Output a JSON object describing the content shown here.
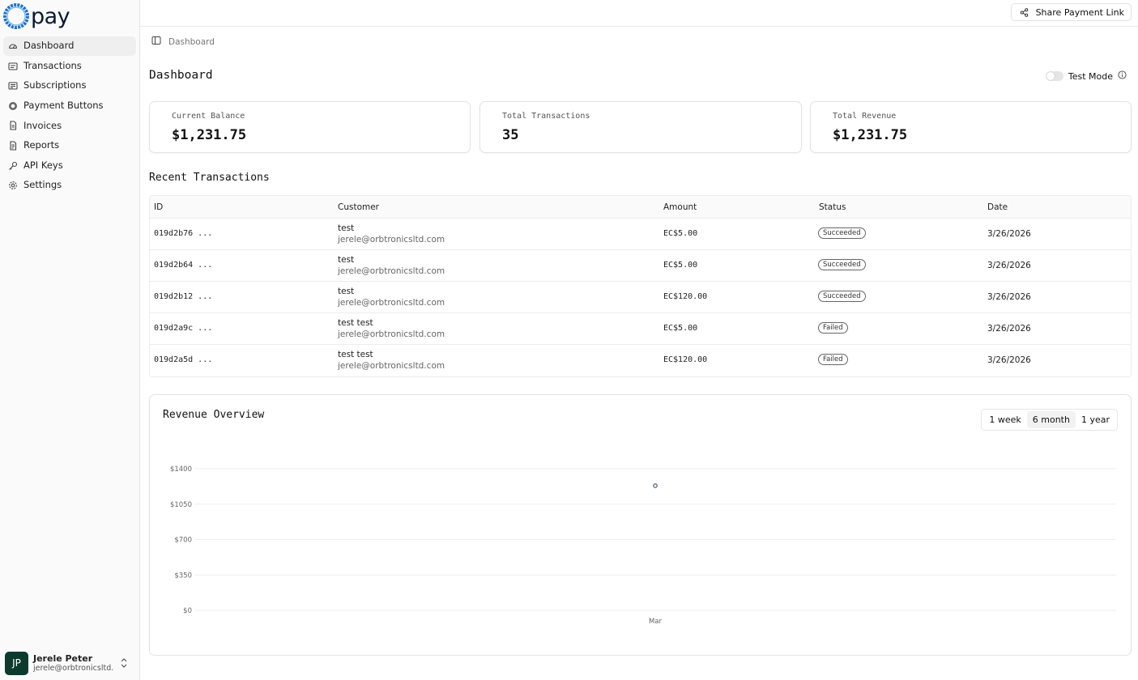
{
  "app": {
    "logo_text": "pay"
  },
  "sidebar": {
    "items": [
      {
        "label": "Dashboard",
        "icon": "gauge-icon",
        "active": true
      },
      {
        "label": "Transactions",
        "icon": "receipt-icon"
      },
      {
        "label": "Subscriptions",
        "icon": "layers-icon"
      },
      {
        "label": "Payment Buttons",
        "icon": "globe-icon"
      },
      {
        "label": "Invoices",
        "icon": "file-icon"
      },
      {
        "label": "Reports",
        "icon": "report-icon"
      },
      {
        "label": "API Keys",
        "icon": "key-icon"
      },
      {
        "label": "Settings",
        "icon": "gear-icon"
      }
    ]
  },
  "user": {
    "initials": "JP",
    "name": "Jerele Peter",
    "email": "jerele@orbtronicsltd...."
  },
  "topbar": {
    "share_label": "Share Payment Link"
  },
  "breadcrumb": {
    "current": "Dashboard"
  },
  "page": {
    "title": "Dashboard",
    "test_mode_label": "Test Mode"
  },
  "stats": {
    "balance": {
      "label": "Current Balance",
      "value": "$1,231.75"
    },
    "transactions": {
      "label": "Total Transactions",
      "value": "35"
    },
    "revenue": {
      "label": "Total Revenue",
      "value": "$1,231.75"
    }
  },
  "recent": {
    "title": "Recent Transactions",
    "columns": [
      "ID",
      "Customer",
      "Amount",
      "Status",
      "Date"
    ],
    "rows": [
      {
        "id": "019d2b76 ...",
        "name": "test",
        "email": "jerele@orbtronicsltd.com",
        "amount": "EC$5.00",
        "status": "Succeeded",
        "date": "3/26/2026"
      },
      {
        "id": "019d2b64 ...",
        "name": "test",
        "email": "jerele@orbtronicsltd.com",
        "amount": "EC$5.00",
        "status": "Succeeded",
        "date": "3/26/2026"
      },
      {
        "id": "019d2b12 ...",
        "name": "test",
        "email": "jerele@orbtronicsltd.com",
        "amount": "EC$120.00",
        "status": "Succeeded",
        "date": "3/26/2026"
      },
      {
        "id": "019d2a9c ...",
        "name": "test test",
        "email": "jerele@orbtronicsltd.com",
        "amount": "EC$5.00",
        "status": "Failed",
        "date": "3/26/2026"
      },
      {
        "id": "019d2a5d ...",
        "name": "test test",
        "email": "jerele@orbtronicsltd.com",
        "amount": "EC$120.00",
        "status": "Failed",
        "date": "3/26/2026"
      }
    ]
  },
  "overview": {
    "title": "Revenue Overview",
    "ranges": [
      {
        "label": "1 week"
      },
      {
        "label": "6 month",
        "active": true
      },
      {
        "label": "1 year"
      }
    ]
  },
  "chart_data": {
    "type": "scatter",
    "categories": [
      "Mar"
    ],
    "series": [
      {
        "values": [
          1231.75
        ]
      }
    ],
    "y_ticks": [
      "$0",
      "$350",
      "$700",
      "$1050",
      "$1400"
    ],
    "ylim": [
      0,
      1400
    ],
    "grid": true,
    "point_color": "#4a6f8a"
  }
}
